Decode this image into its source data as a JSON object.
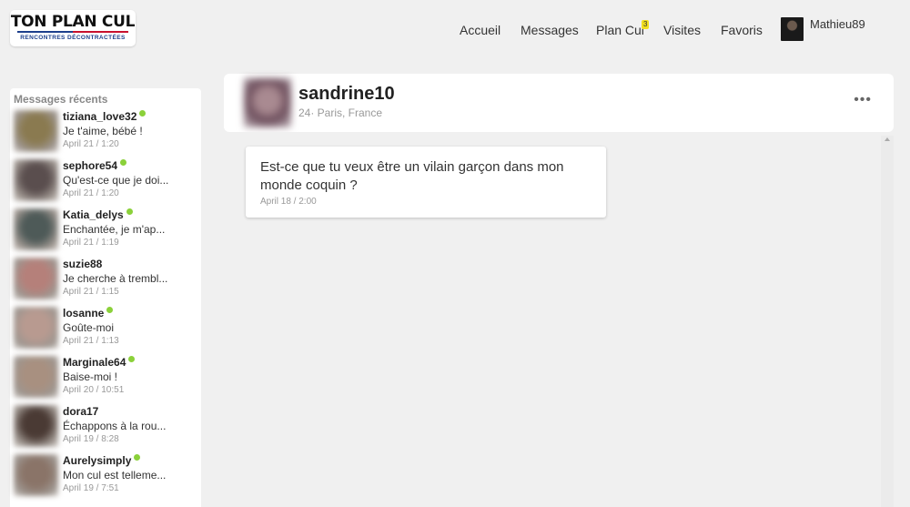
{
  "logo": {
    "main": "TON PLAN CUL",
    "sub": "RENCONTRES DÉCONTRACTÉES"
  },
  "nav": {
    "items": [
      {
        "label": "Accueil"
      },
      {
        "label": "Messages"
      },
      {
        "label": "Plan Cul",
        "badge": "3"
      },
      {
        "label": "Visites"
      },
      {
        "label": "Favoris"
      }
    ],
    "user": {
      "name": "Mathieu89"
    }
  },
  "sidebar": {
    "title": "Messages récents",
    "conversations": [
      {
        "name": "tiziana_love32",
        "online": true,
        "preview": "Je t'aime, bébé !",
        "time": "April 21 / 1:20",
        "avatar_color": "#8a7a50"
      },
      {
        "name": "sephore54",
        "online": true,
        "preview": "Qu'est-ce que je doi...",
        "time": "April 21 / 1:20",
        "avatar_color": "#5a4e4e"
      },
      {
        "name": "Katia_delys",
        "online": true,
        "preview": "Enchantée, je m'ap...",
        "time": "April 21 / 1:19",
        "avatar_color": "#4e5a58"
      },
      {
        "name": "suzie88",
        "online": false,
        "preview": "Je cherche à trembl...",
        "time": "April 21 / 1:15",
        "avatar_color": "#b5807a"
      },
      {
        "name": "losanne",
        "online": true,
        "preview": "Goûte-moi",
        "time": "April 21 / 1:13",
        "avatar_color": "#b89a90"
      },
      {
        "name": "Marginale64",
        "online": true,
        "preview": "Baise-moi !",
        "time": "April 20 / 10:51",
        "avatar_color": "#a89080"
      },
      {
        "name": "dora17",
        "online": false,
        "preview": "Échappons à la rou...",
        "time": "April 19 / 8:28",
        "avatar_color": "#4a3a34"
      },
      {
        "name": "Aurelysimply",
        "online": true,
        "preview": "Mon cul est telleme...",
        "time": "April 19 / 7:51",
        "avatar_color": "#8a7468"
      }
    ]
  },
  "chat": {
    "profile": {
      "name": "sandrine10",
      "meta": "24· Paris, France"
    },
    "more_label": "•••",
    "messages": [
      {
        "text": "Est-ce que tu veux être un vilain garçon dans mon monde coquin ?",
        "time": "April 18 / 2:00"
      }
    ]
  }
}
